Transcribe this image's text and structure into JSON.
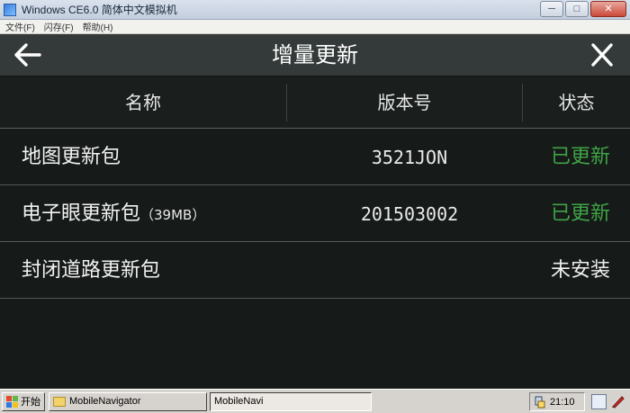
{
  "window": {
    "title": "Windows CE6.0 简体中文模拟机"
  },
  "menu": [
    "文件(F)",
    "闪存(F)",
    "帮助(H)"
  ],
  "app": {
    "title": "增量更新",
    "columns": {
      "name": "名称",
      "version": "版本号",
      "status": "状态"
    },
    "rows": [
      {
        "name": "地图更新包",
        "size": "",
        "version": "3521JON",
        "status": "已更新",
        "status_color": "#3fa446"
      },
      {
        "name": "电子眼更新包",
        "size": "（39MB）",
        "version": "201503002",
        "status": "已更新",
        "status_color": "#3fa446"
      },
      {
        "name": "封闭道路更新包",
        "size": "",
        "version": "",
        "status": "未安装",
        "status_color": "#f0f0f0"
      }
    ]
  },
  "taskbar": {
    "start": "开始",
    "tasks": [
      "MobileNavigator",
      "MobileNavi"
    ],
    "clock": "21:10"
  },
  "icons": {
    "back": "arrow-left-icon",
    "close": "close-icon"
  },
  "colors": {
    "header_bg": "#343a39",
    "screen_bg": "#161a19",
    "updated": "#3fa446"
  }
}
